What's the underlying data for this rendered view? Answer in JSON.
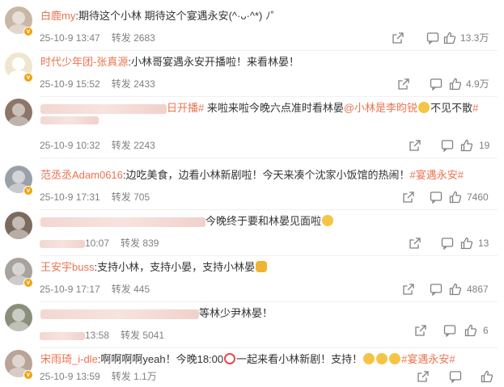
{
  "comments": [
    {
      "user": "白鹿my",
      "text": ":期待这个小林 期待这个宴遇永安(^·ᴗ·^*) ﾉ˚",
      "date": "25-10-9 13:47",
      "repost_label": "转发",
      "repost_count": "2683",
      "likes": "13.3万",
      "avatar_color": "#c9b7a6"
    },
    {
      "user": "时代少年团-张真源",
      "text": ":小林哥宴遇永安开播啦！来看林晏！",
      "date": "25-10-9 15:52",
      "repost_label": "转发",
      "repost_count": "2433",
      "likes": "4.9万",
      "avatar_color": "#efe6cf"
    },
    {
      "user": "日开播#",
      "text": " 来啦来啦今晚六点准时看林晏",
      "mention": "@小林是李昀锐",
      "text2": "不见不散",
      "tag": "#",
      "date": "25-10-9 10:32",
      "repost_label": "转发",
      "repost_count": "2243",
      "likes": "19",
      "avatar_color": "#8c7569"
    },
    {
      "user": "范丞丞Adam0616",
      "text": ":边吃美食，边看小林新剧啦！今天来凑个沈家小饭馆的热闹！",
      "tag": "#宴遇永安#",
      "date": "25-10-9 17:31",
      "repost_label": "转发",
      "repost_count": "705",
      "likes": "7460",
      "avatar_color": "#9aa0a8"
    },
    {
      "user": "",
      "text": "今晚终于要和林晏见面啦",
      "date": "10:07",
      "repost_label": "转发",
      "repost_count": "839",
      "likes": "13",
      "avatar_color": "#7d6a5e"
    },
    {
      "user": "王安宇buss",
      "text": ":支持小林，支持小晏，支持小林晏",
      "date": "25-10-9 17:17",
      "repost_label": "转发",
      "repost_count": "445",
      "likes": "4867",
      "avatar_color": "#a7a29e"
    },
    {
      "user": "",
      "text": "等林少尹林晏！",
      "date": "13:58",
      "repost_label": "转发",
      "repost_count": "5041",
      "likes": "6",
      "avatar_color": "#8a8f7c"
    },
    {
      "user": "宋雨琦_i-dle",
      "text": ":啊啊啊啊yeah！今晚18:00",
      "text2": "一起来看小林新剧！支持！",
      "tag": "#宴遇永安#",
      "date": "25-10-9 13:59",
      "repost_label": "转发",
      "repost_count": "1.1万",
      "likes": "",
      "avatar_color": "#b9a597"
    }
  ],
  "colors": {
    "username": "#eb7350",
    "meta": "#808080",
    "badge": "#f2a20c",
    "blur": "#f3d7d0"
  },
  "icons": [
    "share-icon",
    "comment-icon",
    "like-icon",
    "verified-badge-icon"
  ]
}
